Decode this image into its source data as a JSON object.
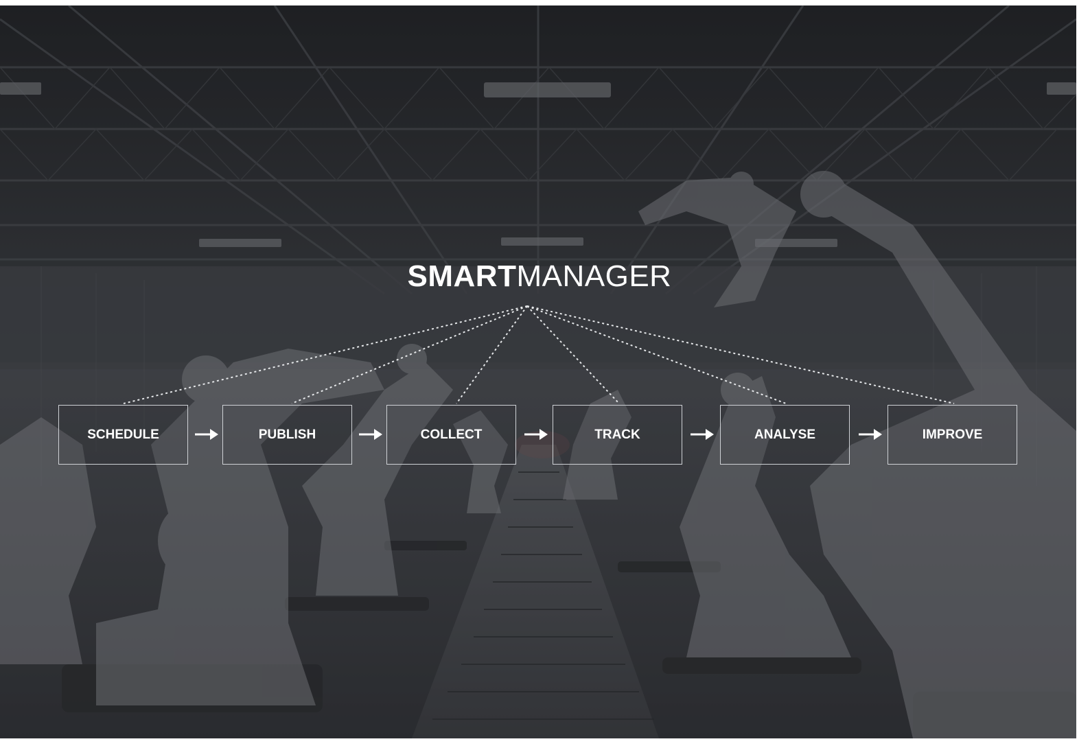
{
  "title": {
    "bold": "SMART",
    "light": "MANAGER"
  },
  "steps": [
    {
      "label": "SCHEDULE"
    },
    {
      "label": "PUBLISH"
    },
    {
      "label": "COLLECT"
    },
    {
      "label": "TRACK"
    },
    {
      "label": "ANALYSE"
    },
    {
      "label": "IMPROVE"
    }
  ],
  "icons": {
    "arrow": "right-arrow-icon"
  },
  "colors": {
    "background": "#2e3033",
    "text": "#ffffff",
    "box_border": "#cfd2d6",
    "connector": "#e6e8ea"
  }
}
